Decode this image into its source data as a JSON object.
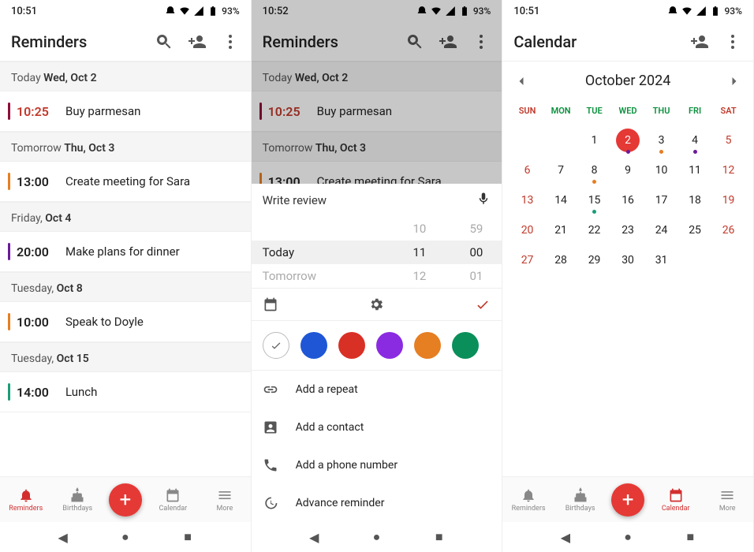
{
  "statusBar": {
    "time1": "10:51",
    "time2": "10:52",
    "time3": "10:51",
    "battery": "93%"
  },
  "screen1": {
    "title": "Reminders",
    "sections": [
      {
        "prefix": "Today ",
        "day": "Wed, Oct 2",
        "items": [
          {
            "time": "10:25",
            "title": "Buy parmesan",
            "timeRed": true,
            "bar": "bar-red"
          }
        ]
      },
      {
        "prefix": "Tomorrow ",
        "day": "Thu, Oct 3",
        "items": [
          {
            "time": "13:00",
            "title": "Create meeting for Sara",
            "bar": "bar-orange"
          }
        ]
      },
      {
        "prefix": "Friday, ",
        "day": "Oct 4",
        "items": [
          {
            "time": "20:00",
            "title": "Make plans for dinner",
            "bar": "bar-purple"
          }
        ]
      },
      {
        "prefix": "Tuesday, ",
        "day": "Oct 8",
        "items": [
          {
            "time": "10:00",
            "title": "Speak to Doyle",
            "bar": "bar-orange"
          }
        ]
      },
      {
        "prefix": "Tuesday, ",
        "day": "Oct 15",
        "items": [
          {
            "time": "14:00",
            "title": "Lunch",
            "bar": "bar-green"
          }
        ]
      }
    ],
    "nav": {
      "reminders": "Reminders",
      "birthdays": "Birthdays",
      "calendar": "Calendar",
      "more": "More"
    }
  },
  "screen2": {
    "title": "Reminders",
    "input": "Write review",
    "wheel": [
      {
        "label": "",
        "h": "10",
        "m": "59",
        "active": false
      },
      {
        "label": "Today",
        "h": "11",
        "m": "00",
        "active": true
      },
      {
        "label": "Tomorrow",
        "h": "12",
        "m": "01",
        "active": false
      }
    ],
    "colors": [
      "#fff",
      "#1e56d6",
      "#d93025",
      "#8a2be2",
      "#e67e22",
      "#0a8f5a"
    ],
    "options": [
      "Add a repeat",
      "Add a contact",
      "Add a phone number",
      "Advance reminder"
    ]
  },
  "screen3": {
    "title": "Calendar",
    "month": "October 2024",
    "dow": [
      "SUN",
      "MON",
      "TUE",
      "WED",
      "THU",
      "FRI",
      "SAT"
    ],
    "weeks": [
      [
        null,
        null,
        {
          "n": 1
        },
        {
          "n": 2,
          "today": true,
          "dot": "purple"
        },
        {
          "n": 3,
          "dot": "orange"
        },
        {
          "n": 4,
          "dot": "purple"
        },
        {
          "n": 5,
          "red": true
        }
      ],
      [
        {
          "n": 6,
          "red": true
        },
        {
          "n": 7
        },
        {
          "n": 8,
          "dot": "orange"
        },
        {
          "n": 9
        },
        {
          "n": 10
        },
        {
          "n": 11
        },
        {
          "n": 12,
          "red": true
        }
      ],
      [
        {
          "n": 13,
          "red": true
        },
        {
          "n": 14
        },
        {
          "n": 15,
          "dot": "green"
        },
        {
          "n": 16
        },
        {
          "n": 17
        },
        {
          "n": 18
        },
        {
          "n": 19,
          "red": true
        }
      ],
      [
        {
          "n": 20,
          "red": true
        },
        {
          "n": 21
        },
        {
          "n": 22
        },
        {
          "n": 23
        },
        {
          "n": 24
        },
        {
          "n": 25
        },
        {
          "n": 26,
          "red": true
        }
      ],
      [
        {
          "n": 27,
          "red": true
        },
        {
          "n": 28
        },
        {
          "n": 29
        },
        {
          "n": 30
        },
        {
          "n": 31
        },
        null,
        null
      ]
    ],
    "nav": {
      "reminders": "Reminders",
      "birthdays": "Birthdays",
      "calendar": "Calendar",
      "more": "More"
    }
  }
}
